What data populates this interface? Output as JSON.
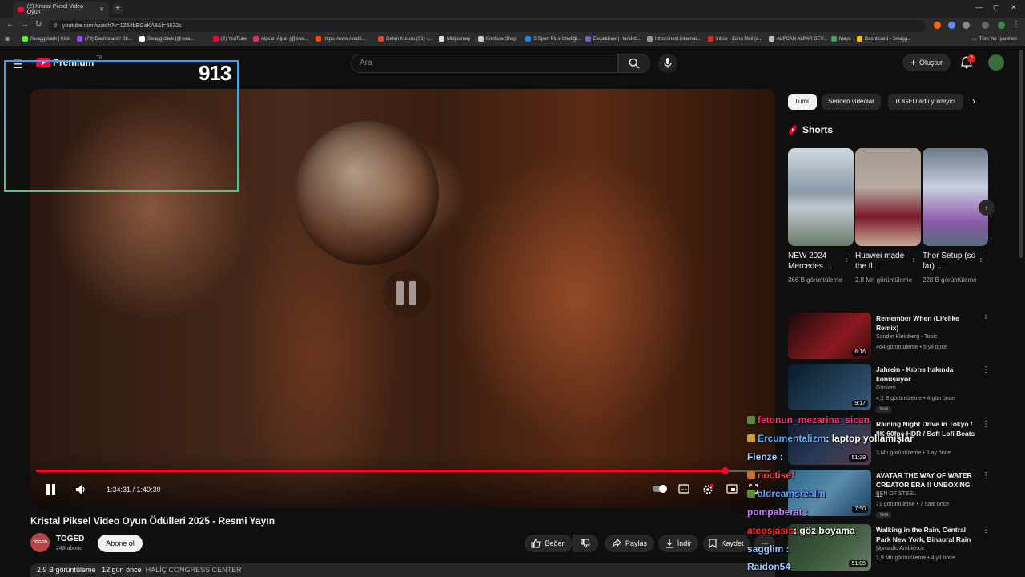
{
  "browser": {
    "tab_title": "(2) Kristal Piksel Video Oyun",
    "url": "youtube.com/watch?v=1Z54bEGaKA8&t=5632s",
    "bookmarks": [
      {
        "label": "Swaggybark | Kick",
        "color": "#53fc18"
      },
      {
        "label": "(79) Dashboard / Str...",
        "color": "#9146ff"
      },
      {
        "label": "Swaggybark (@swa...",
        "color": "#ffffff"
      },
      {
        "label": "(2) YouTube",
        "color": "#ff0033"
      },
      {
        "label": "Alpcan Alpar (@swa...",
        "color": "#e1306c"
      },
      {
        "label": "https://www.reddit....",
        "color": "#ff4500"
      },
      {
        "label": "Gelen Kutusu (31) -...",
        "color": "#ea4335"
      },
      {
        "label": "Midjourney",
        "color": "#dddddd"
      },
      {
        "label": "Konfuse Shop",
        "color": "#cccccc"
      },
      {
        "label": "S Sport Plus-İstediği...",
        "color": "#1e88e5"
      },
      {
        "label": "Excalidraw | Hand-d...",
        "color": "#6965db"
      },
      {
        "label": "https://nest.inkamat...",
        "color": "#999999"
      },
      {
        "label": "Inbox - Zoho Mail (a...",
        "color": "#e42527"
      },
      {
        "label": "ALPCAN ALPAR DEV...",
        "color": "#bbbbbb"
      },
      {
        "label": "Maps",
        "color": "#34a853"
      },
      {
        "label": "Dashboard - Swagg...",
        "color": "#fbbc04"
      }
    ],
    "all_bookmarks_label": "Tüm Yer İşaretleri"
  },
  "header": {
    "logo_text": "Premium",
    "logo_region": "TR",
    "search_placeholder": "Ara",
    "create_label": "Oluştur",
    "notification_count": "2"
  },
  "overlay": {
    "viewer_count": "913"
  },
  "player": {
    "current_time": "1:34:31",
    "duration": "1:40:30",
    "time_display": "1:34:31 / 1:40:30",
    "progress_fraction": 0.9403
  },
  "video": {
    "title": "Kristal Piksel Video Oyun Ödülleri 2025 - Resmi Yayın",
    "channel_name": "TOGED",
    "channel_avatar_text": "TOGED",
    "subscribers": "248 abone",
    "subscribe_label": "Abone ol",
    "like_label": "Beğen",
    "share_label": "Paylaş",
    "download_label": "İndir",
    "save_label": "Kaydet",
    "views": "2,9 B görüntüleme",
    "date": "12 gün önce",
    "location": "HALİÇ CONGRESS CENTER"
  },
  "sidebar": {
    "chips": [
      "Tümü",
      "Seriden videolar",
      "TOGED adlı yükleyici"
    ],
    "shorts_heading": "Shorts",
    "shorts": [
      {
        "title": "NEW 2024 Mercedes ...",
        "views": "366 B görüntüleme",
        "color": "#8a9aa8"
      },
      {
        "title": "Huawei made the fl...",
        "views": "2,8 Mn görüntüleme",
        "color": "#b8aaa0"
      },
      {
        "title": "Thor Setup (so far) ...",
        "views": "228 B görüntüleme",
        "color": "#7a8a9a"
      }
    ],
    "videos": [
      {
        "title": "Remember When (Lifelike Remix)",
        "channel": "Sander Kleinberg - Topic",
        "meta": "464 görüntüleme • 5 yıl önce",
        "duration": "6:16",
        "new": "",
        "color": "#8a1a20"
      },
      {
        "title": "Jahrein - Kıbrıs hakında konuşuyor",
        "channel": "Görkem",
        "meta": "4,2 B görüntüleme • 4 gün önce",
        "duration": "9:17",
        "new": "Yeni",
        "color": "#1e3a52"
      },
      {
        "title": "Raining Night Drive in Tokyo / 8K 60fps HDR / Soft Lofi Beats",
        "channel": "",
        "meta": "3 Mn görüntüleme • 5 ay önce",
        "duration": "51:29",
        "new": "",
        "color": "#2a3a55"
      },
      {
        "title": "AVATAR THE WAY OF WATER CREATOR ERA !! UNBOXING ...",
        "channel": "BEN OF STEEL",
        "meta": "71 görüntüleme • 7 saat önce",
        "duration": "7:50",
        "new": "Yeni",
        "color": "#2a6a8a"
      },
      {
        "title": "Walking in the Rain, Central Park New York, Binaural Rain ...",
        "channel": "Nomadic Ambience",
        "meta": "1,9 Mn görüntüleme • 4 yıl önce",
        "duration": "51:05",
        "new": "",
        "color": "#3a5a3a"
      }
    ]
  },
  "chat": [
    {
      "user": "fetonun_mezarina_sican",
      "message": "",
      "color": "#ff2e6b"
    },
    {
      "user": "Ercumentalizm",
      "message": ": laptop yollamışlar",
      "color": "#5ab0ff"
    },
    {
      "user": "Fienze :",
      "message": "",
      "color": "#9ec9ff"
    },
    {
      "user": "noctisef",
      "message": "",
      "color": "#ff4040"
    },
    {
      "user": "aldreamsrealm",
      "message": "",
      "color": "#6aa0ff"
    },
    {
      "user": "pompaberat :",
      "message": "",
      "color": "#c67bff"
    },
    {
      "user": "ateosjasis",
      "message": ": göz boyama",
      "color": "#ff3030"
    },
    {
      "user": "sagglim :",
      "message": "",
      "color": "#9ec9ff"
    },
    {
      "user": "Raidon54",
      "message": "",
      "color": "#9ec9ff"
    }
  ]
}
